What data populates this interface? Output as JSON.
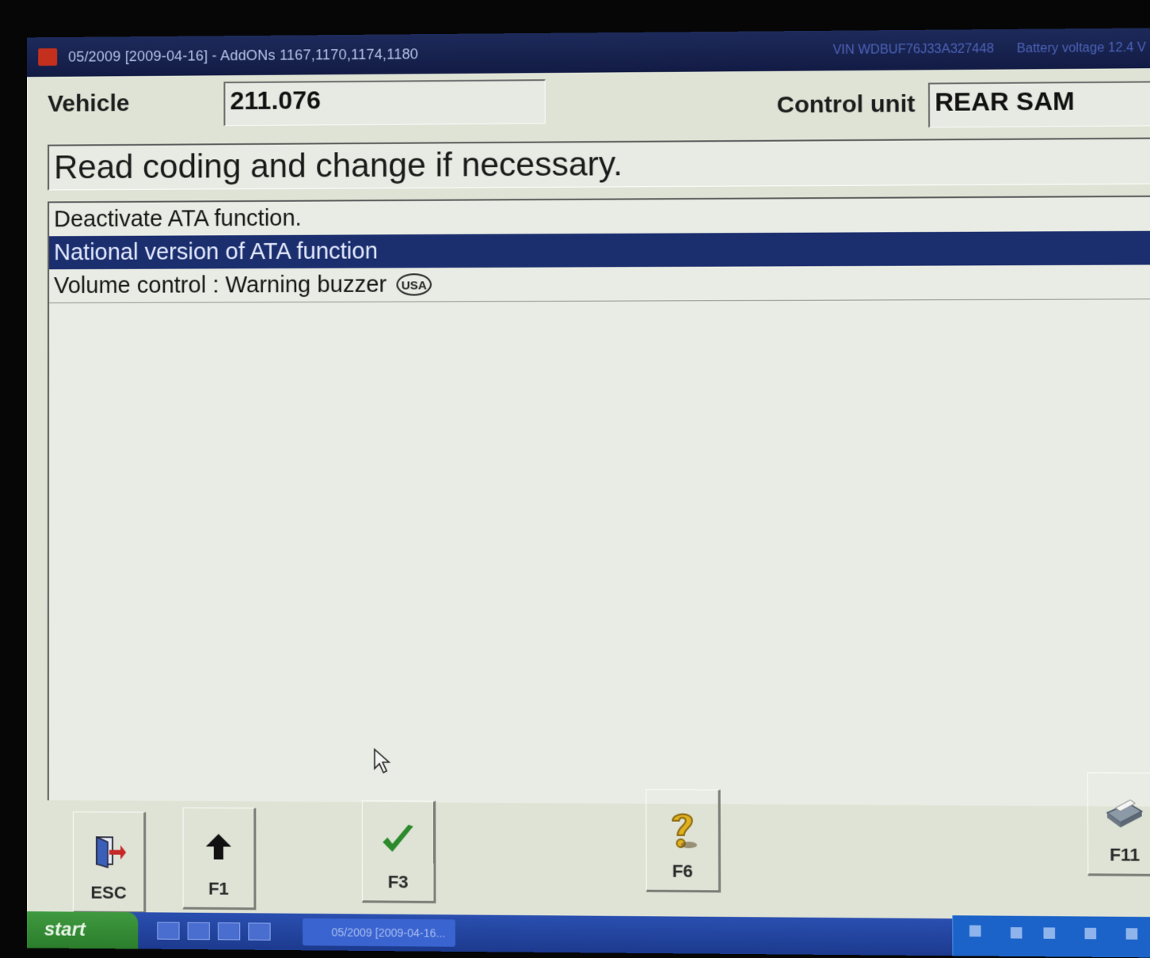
{
  "window": {
    "title": "05/2009 [2009-04-16] - AddONs 1167,1170,1174,1180",
    "vin": "VIN WDBUF76J33A327448",
    "battery": "Battery voltage 12.4 V"
  },
  "header": {
    "vehicle_label": "Vehicle",
    "vehicle_value": "211.076",
    "control_unit_label": "Control unit",
    "control_unit_value": "REAR SAM"
  },
  "instruction": "Read coding and change if necessary.",
  "list": {
    "items": [
      {
        "label": "Deactivate ATA function.",
        "selected": false
      },
      {
        "label": "National version of ATA function",
        "selected": true
      },
      {
        "label": "Volume control : Warning buzzer",
        "selected": false,
        "badge": "USA"
      }
    ]
  },
  "buttons": {
    "esc": {
      "label": "ESC",
      "icon": "exit-door-icon"
    },
    "f1": {
      "label": "F1",
      "icon": "arrow-up-icon"
    },
    "f3": {
      "label": "F3",
      "icon": "checkmark-icon"
    },
    "f6": {
      "label": "F6",
      "icon": "help-question-icon"
    },
    "f11": {
      "label": "F11",
      "icon": "printer-icon"
    }
  },
  "taskbar": {
    "start_label": "start",
    "task_label": "05/2009 [2009-04-16..."
  },
  "colors": {
    "titlebar": "#121b44",
    "selection": "#1b2e6e",
    "background": "#dfe3d6",
    "check": "#2c8a2c",
    "help": "#e0b020"
  }
}
